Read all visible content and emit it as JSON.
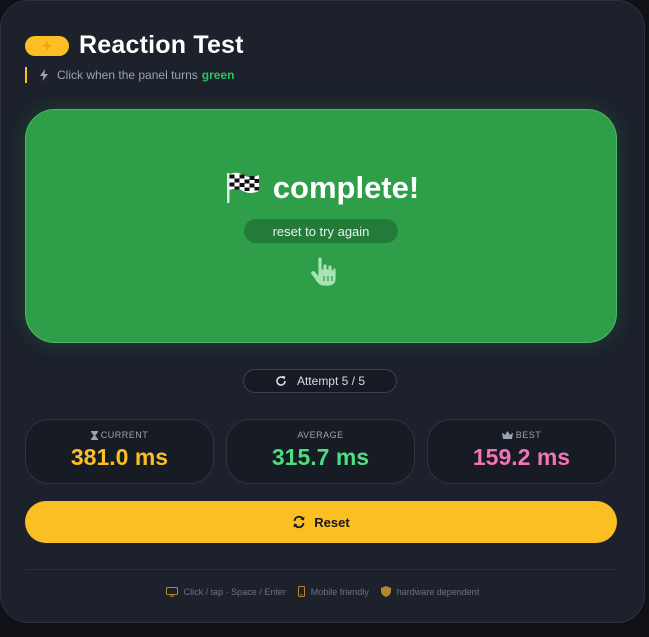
{
  "header": {
    "title": "Reaction Test",
    "subtitle_text": "Click when the panel turns",
    "subtitle_emphasis": "green",
    "icon": "bolt-icon"
  },
  "panel": {
    "status": "complete!",
    "status_icon": "checkered-flag-icon",
    "hint": "reset to try again",
    "cursor_icon": "pointer-hand-icon",
    "color": "#2f9e49"
  },
  "attempt": {
    "label": "Attempt 5 / 5",
    "icon": "refresh-icon"
  },
  "stats": {
    "current": {
      "label": "CURRENT",
      "value": "381.0 ms",
      "icon": "hourglass-icon",
      "color": "#fbbf24"
    },
    "average": {
      "label": "AVERAGE",
      "value": "315.7 ms",
      "color": "#4ade80"
    },
    "best": {
      "label": "BEST",
      "value": "159.2 ms",
      "icon": "crown-icon",
      "color": "#f472b6"
    }
  },
  "reset_button": {
    "label": "Reset",
    "icon": "sync-icon"
  },
  "footer": {
    "controls": "Click / tap · Space / Enter",
    "mobile": "Mobile friendly",
    "hardware": "hardware dependent"
  },
  "colors": {
    "accent": "#fbbf24",
    "success": "#22c55e",
    "background": "#1c212c"
  }
}
